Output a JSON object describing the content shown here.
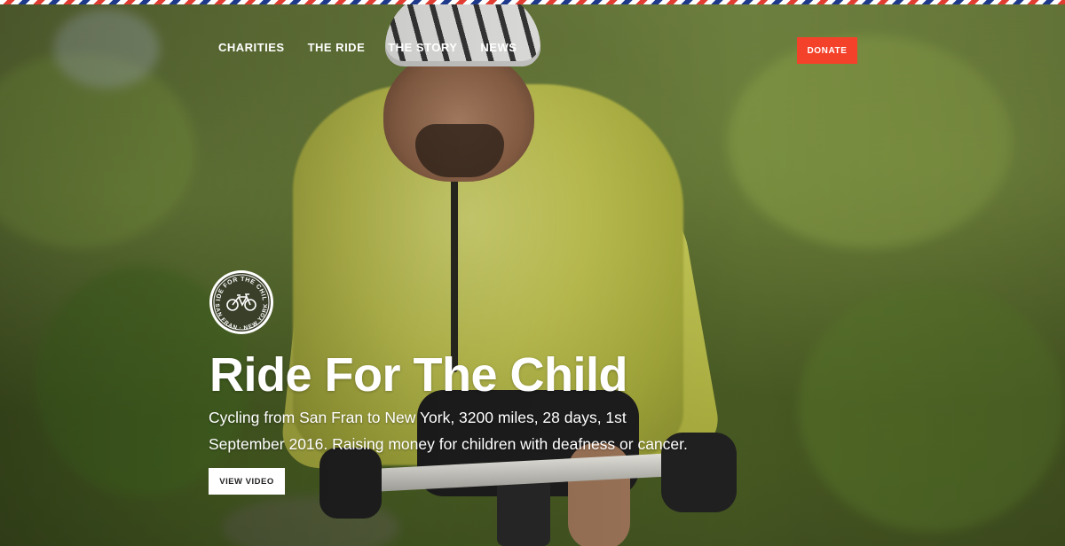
{
  "nav": {
    "items": [
      {
        "label": "CHARITIES"
      },
      {
        "label": "THE RIDE"
      },
      {
        "label": "THE STORY"
      },
      {
        "label": "NEWS"
      }
    ],
    "donate_label": "DONATE"
  },
  "logo": {
    "top_text": "RIDE FOR THE CHILD",
    "bottom_text": "SAN FRAN · NEW YORK",
    "icon": "bicycle-icon"
  },
  "hero": {
    "title": "Ride For The Child",
    "description": "Cycling from San Fran to New York, 3200 miles, 28 days, 1st September 2016. Raising money for children with deafness or cancer.",
    "video_button_label": "VIEW VIDEO"
  },
  "colors": {
    "accent": "#f4412a",
    "stripe_red": "#e03c31",
    "stripe_blue": "#1f3a8a",
    "text": "#ffffff"
  }
}
